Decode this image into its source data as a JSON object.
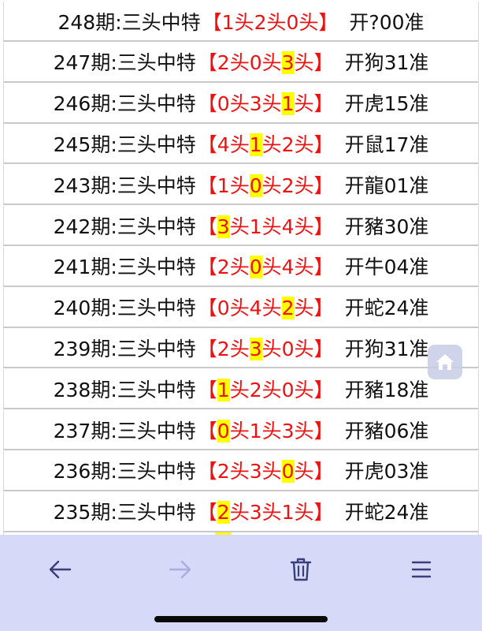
{
  "rows": [
    {
      "period": "248期:三头中特",
      "p1": "1",
      "p2": "2",
      "p3": "0",
      "hl": 0,
      "kw": "开?00准"
    },
    {
      "period": "247期:三头中特",
      "p1": "2",
      "p2": "0",
      "p3": "3",
      "hl": 3,
      "kw": "开狗31准"
    },
    {
      "period": "246期:三头中特",
      "p1": "0",
      "p2": "3",
      "p3": "1",
      "hl": 3,
      "kw": "开虎15准"
    },
    {
      "period": "245期:三头中特",
      "p1": "4",
      "p2": "1",
      "p3": "2",
      "hl": 2,
      "kw": "开鼠17准"
    },
    {
      "period": "243期:三头中特",
      "p1": "1",
      "p2": "0",
      "p3": "2",
      "hl": 2,
      "kw": "开龍01准"
    },
    {
      "period": "242期:三头中特",
      "p1": "3",
      "p2": "1",
      "p3": "4",
      "hl": 1,
      "kw": "开豬30准"
    },
    {
      "period": "241期:三头中特",
      "p1": "2",
      "p2": "0",
      "p3": "4",
      "hl": 2,
      "kw": "开牛04准"
    },
    {
      "period": "240期:三头中特",
      "p1": "0",
      "p2": "4",
      "p3": "2",
      "hl": 3,
      "kw": "开蛇24准"
    },
    {
      "period": "239期:三头中特",
      "p1": "2",
      "p2": "3",
      "p3": "0",
      "hl": 2,
      "kw": "开狗31准"
    },
    {
      "period": "238期:三头中特",
      "p1": "1",
      "p2": "2",
      "p3": "0",
      "hl": 1,
      "kw": "开豬18准"
    },
    {
      "period": "237期:三头中特",
      "p1": "0",
      "p2": "1",
      "p3": "3",
      "hl": 1,
      "kw": "开豬06准"
    },
    {
      "period": "236期:三头中特",
      "p1": "2",
      "p2": "3",
      "p3": "0",
      "hl": 3,
      "kw": "开虎03准"
    },
    {
      "period": "235期:三头中特",
      "p1": "2",
      "p2": "3",
      "p3": "1",
      "hl": 1,
      "kw": "开蛇24准"
    }
  ],
  "symbols": {
    "open_bracket": "【",
    "close_bracket": "】",
    "head": "头"
  },
  "icons": {
    "home": "home-icon",
    "back": "arrow-left-icon",
    "forward": "arrow-right-icon",
    "delete": "trash-icon",
    "menu": "menu-icon"
  },
  "colors": {
    "prediction_text": "#ee1111",
    "highlight": "#ffff00",
    "toolbar_bg": "#d6d9f7",
    "forward_disabled": "#a9addf"
  }
}
